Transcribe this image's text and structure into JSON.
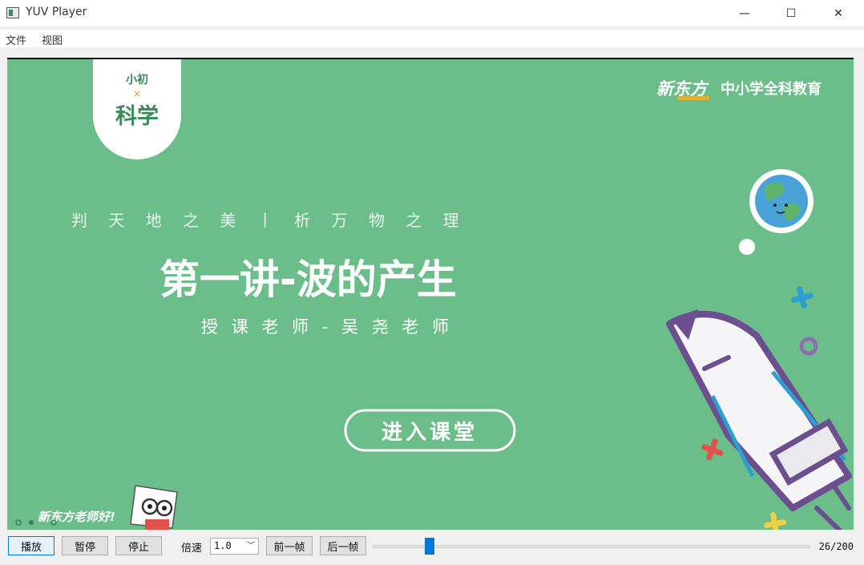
{
  "window": {
    "title": "YUV Player",
    "minimize": "—",
    "maximize": "☐",
    "close": "✕"
  },
  "menu": [
    {
      "label": "文件"
    },
    {
      "label": "视图"
    }
  ],
  "video": {
    "badge_top": "小初",
    "badge_x": "×",
    "badge_subject": "科学",
    "brand_logo": "新东方",
    "brand_sub": "中小学全科教育",
    "motto": "判 天 地 之 美 丨 析 万 物 之 理",
    "lecture_title": "第一讲-波的产生",
    "teacher": "授 课 老 师 - 吴 尧 老 师",
    "enter_button": "进入课堂",
    "greeting": "新东方老师好!"
  },
  "controls": {
    "play": "播放",
    "pause": "暂停",
    "stop": "停止",
    "speed_label": "倍速",
    "speed_value": "1.0",
    "prev_frame": "前一帧",
    "next_frame": "后一帧",
    "frame_counter": "26/200",
    "progress_fraction": 0.13
  },
  "colors": {
    "video_bg": "#6bbd8a",
    "accent": "#0078d7",
    "rocket_outline": "#6b4f8f"
  }
}
